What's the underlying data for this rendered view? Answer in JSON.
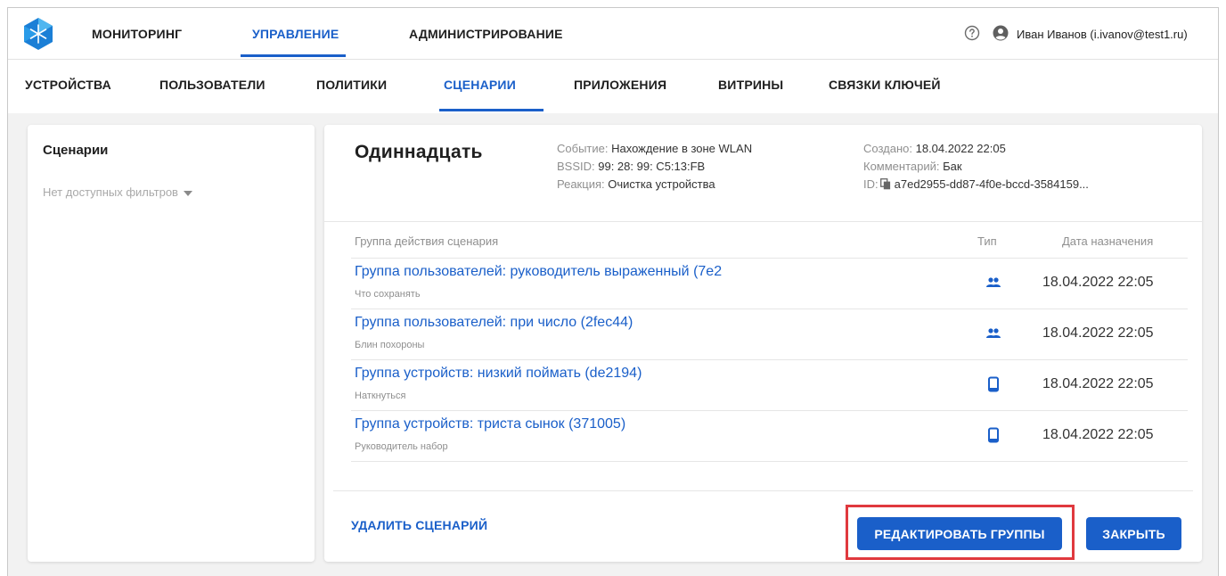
{
  "topnav": {
    "items": [
      {
        "label": "МОНИТОРИНГ"
      },
      {
        "label": "УПРАВЛЕНИЕ"
      },
      {
        "label": "АДМИНИСТРИРОВАНИЕ"
      }
    ],
    "active": "УПРАВЛЕНИЕ",
    "user": "Иван Иванов (i.ivanov@test1.ru)"
  },
  "subnav": {
    "items": [
      {
        "label": "УСТРОЙСТВА"
      },
      {
        "label": "ПОЛЬЗОВАТЕЛИ"
      },
      {
        "label": "ПОЛИТИКИ"
      },
      {
        "label": "СЦЕНАРИИ"
      },
      {
        "label": "ПРИЛОЖЕНИЯ"
      },
      {
        "label": "ВИТРИНЫ"
      },
      {
        "label": "СВЯЗКИ КЛЮЧЕЙ"
      }
    ],
    "active": "СЦЕНАРИИ"
  },
  "left": {
    "title": "Сценарии",
    "filter": "Нет доступных фильтров"
  },
  "scenario": {
    "title": "Одиннадцать",
    "event_label": "Событие:",
    "event_value": "Нахождение в зоне WLAN",
    "bssid_label": "BSSID:",
    "bssid_value": "99: 28: 99: C5:13:FB",
    "reaction_label": "Реакция:",
    "reaction_value": "Очистка устройства",
    "created_label": "Создано:",
    "created_value": "18.04.2022 22:05",
    "comment_label": "Комментарий:",
    "comment_value": "Бак",
    "id_label": "ID:",
    "id_value": "a7ed2955-dd87-4f0e-bccd-3584159..."
  },
  "table": {
    "headers": {
      "group": "Группа действия сценария",
      "type": "Тип",
      "date": "Дата назначения"
    },
    "rows": [
      {
        "title": "Группа пользователей: руководитель выраженный (7e2",
        "subtitle": "Что сохранять",
        "type_icon": "users-icon",
        "date": "18.04.2022 22:05"
      },
      {
        "title": "Группа пользователей: при число (2fec44)",
        "subtitle": "Блин похороны",
        "type_icon": "users-icon",
        "date": "18.04.2022 22:05"
      },
      {
        "title": "Группа устройств: низкий поймать (de2194)",
        "subtitle": "Наткнуться",
        "type_icon": "device-icon",
        "date": "18.04.2022 22:05"
      },
      {
        "title": "Группа устройств: триста сынок (371005)",
        "subtitle": "Руководитель набор",
        "type_icon": "device-icon",
        "date": "18.04.2022 22:05"
      }
    ]
  },
  "footer": {
    "delete_label": "УДАЛИТЬ СЦЕНАРИЙ",
    "edit_label": "РЕДАКТИРОВАТЬ ГРУППЫ",
    "close_label": "ЗАКРЫТЬ"
  },
  "colors": {
    "accent": "#1a5fc9",
    "highlight": "#e0393e",
    "background": "#f2f2f2"
  }
}
